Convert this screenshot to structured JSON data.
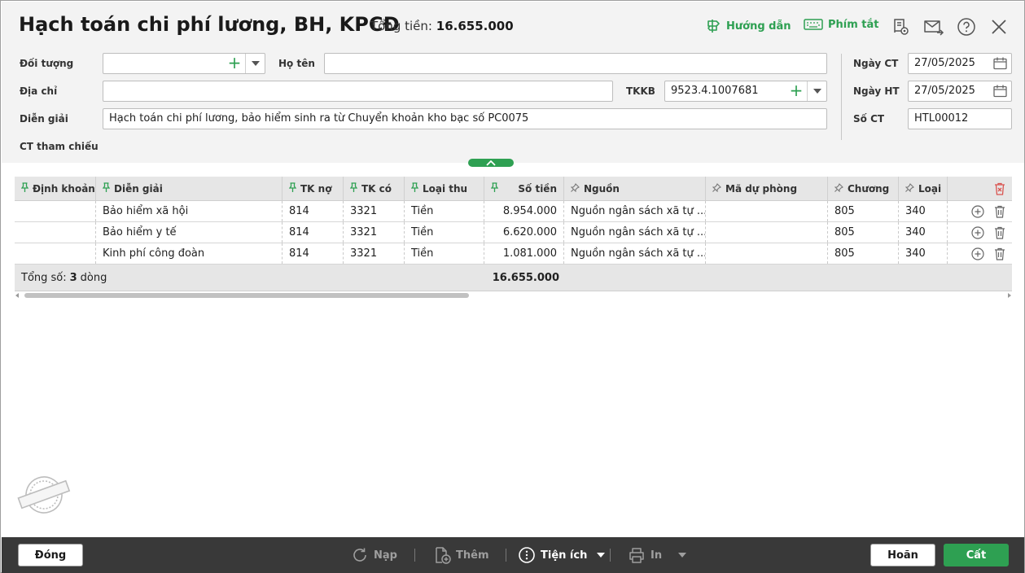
{
  "header": {
    "title": "Hạch toán chi phí lương, BH, KPCĐ",
    "total_label": "Tổng tiền:",
    "total_value": "16.655.000",
    "guide_label": "Hướng dẫn",
    "shortcut_label": "Phím tắt"
  },
  "form": {
    "doi_tuong_label": "Đối tượng",
    "doi_tuong_value": "",
    "ho_ten_label": "Họ tên",
    "ho_ten_value": "",
    "dia_chi_label": "Địa chỉ",
    "dia_chi_value": "",
    "tkkb_label": "TKKB",
    "tkkb_value": "9523.4.1007681",
    "dien_giai_label": "Diễn giải",
    "dien_giai_value": "Hạch toán chi phí lương, bảo hiểm sinh ra từ Chuyển khoản kho bạc số PC0075",
    "ct_tham_chieu_label": "CT tham chiếu",
    "ngay_ct_label": "Ngày CT",
    "ngay_ct_value": "27/05/2025",
    "ngay_ht_label": "Ngày HT",
    "ngay_ht_value": "27/05/2025",
    "so_ct_label": "Số CT",
    "so_ct_value": "HTL00012"
  },
  "grid": {
    "columns": [
      "Định khoản",
      "Diễn giải",
      "TK nợ",
      "TK có",
      "Loại thu",
      "Số tiền",
      "Nguồn",
      "Mã dự phòng",
      "Chương",
      "Loại"
    ],
    "rows": [
      {
        "dinh_khoan": "",
        "dien_giai": "Bảo hiểm xã hội",
        "tk_no": "814",
        "tk_co": "3321",
        "loai_thu": "Tiền",
        "so_tien": "8.954.000",
        "nguon": "Nguồn ngân sách xã tự ...",
        "ma_du_phong": "",
        "chuong": "805",
        "loai": "340"
      },
      {
        "dinh_khoan": "",
        "dien_giai": "Bảo hiểm y tế",
        "tk_no": "814",
        "tk_co": "3321",
        "loai_thu": "Tiền",
        "so_tien": "6.620.000",
        "nguon": "Nguồn ngân sách xã tự ...",
        "ma_du_phong": "",
        "chuong": "805",
        "loai": "340"
      },
      {
        "dinh_khoan": "",
        "dien_giai": "Kinh phí công đoàn",
        "tk_no": "814",
        "tk_co": "3321",
        "loai_thu": "Tiền",
        "so_tien": "1.081.000",
        "nguon": "Nguồn ngân sách xã tự ...",
        "ma_du_phong": "",
        "chuong": "805",
        "loai": "340"
      }
    ],
    "footer_label": "Tổng số:",
    "footer_count": "3",
    "footer_unit": "dòng",
    "footer_total": "16.655.000"
  },
  "footer": {
    "close_label": "Đóng",
    "reload_label": "Nạp",
    "add_label": "Thêm",
    "utility_label": "Tiện ích",
    "print_label": "In",
    "cancel_label": "Hoãn",
    "save_label": "Cất"
  },
  "colors": {
    "accent": "#2ea052",
    "footer_bg": "#393939",
    "header_bg": "#f3f3f3"
  }
}
